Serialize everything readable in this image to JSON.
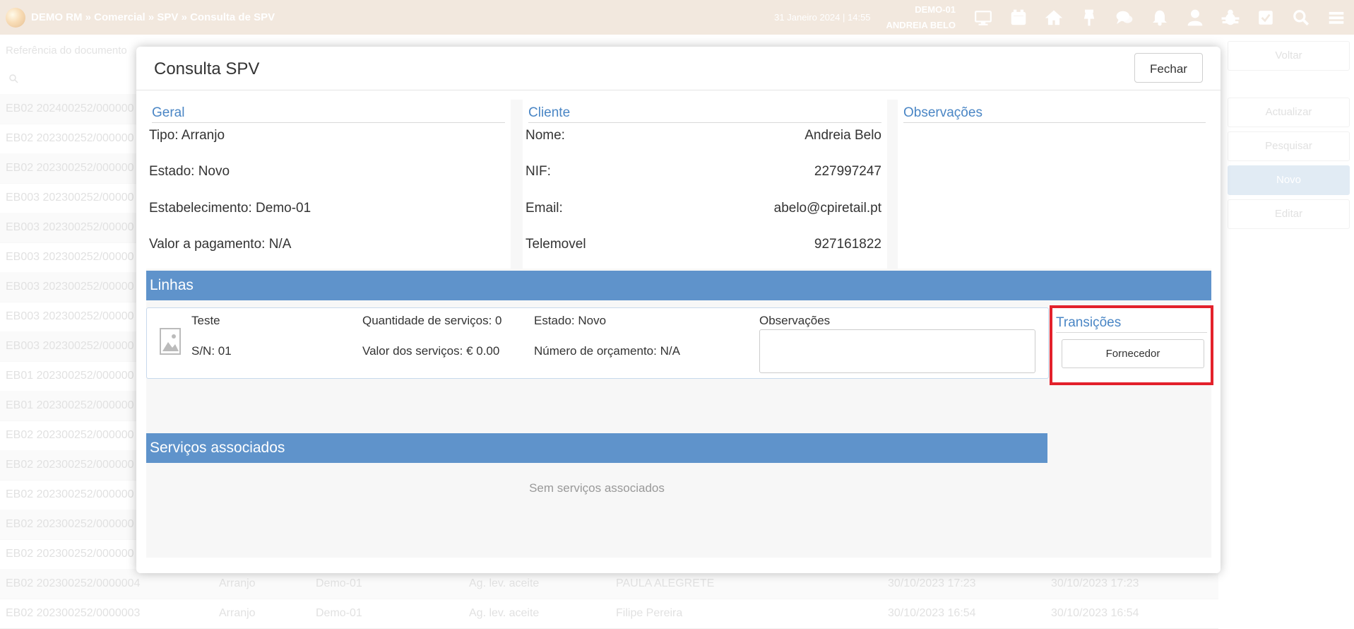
{
  "topbar": {
    "breadcrumb": "DEMO RM » Comercial » SPV » Consulta de SPV",
    "datetime": "31 Janeiro 2024 | 14:55",
    "store": "DEMO-01",
    "user": "ANDREIA BELO",
    "icons": [
      "monitor-icon",
      "calendar-icon",
      "home-icon",
      "pin-icon",
      "chat-icon",
      "bell-icon",
      "user-icon",
      "bug-icon",
      "checkbox-icon",
      "search-icon",
      "menu-icon"
    ]
  },
  "background": {
    "filter_placeholder": "Referência do documento",
    "rows": [
      {
        "ref": "EB02 202400252/000000"
      },
      {
        "ref": "EB02 202300252/000000"
      },
      {
        "ref": "EB02 202300252/000000"
      },
      {
        "ref": "EB003 202300252/00000"
      },
      {
        "ref": "EB003 202300252/00000"
      },
      {
        "ref": "EB003 202300252/00000"
      },
      {
        "ref": "EB003 202300252/00000"
      },
      {
        "ref": "EB003 202300252/00000"
      },
      {
        "ref": "EB003 202300252/00000"
      },
      {
        "ref": "EB01 202300252/000000"
      },
      {
        "ref": "EB01 202300252/000000"
      },
      {
        "ref": "EB02 202300252/000000"
      },
      {
        "ref": "EB02 202300252/000000"
      },
      {
        "ref": "EB02 202300252/000000"
      },
      {
        "ref": "EB02 202300252/000000"
      },
      {
        "ref": "EB02 202300252/000000"
      },
      {
        "ref": "EB02 202300252/0000004",
        "tipo": "Arranjo",
        "estab": "Demo-01",
        "estado": "Ag. lev. aceite",
        "cliente": "PAULA ALEGRETE",
        "d1": "30/10/2023 17:23",
        "d2": "30/10/2023 17:23"
      },
      {
        "ref": "EB02 202300252/0000003",
        "tipo": "Arranjo",
        "estab": "Demo-01",
        "estado": "Ag. lev. aceite",
        "cliente": "Filipe Pereira",
        "d1": "30/10/2023 16:54",
        "d2": "30/10/2023 16:54"
      }
    ],
    "side_buttons": {
      "voltar": "Voltar",
      "actualizar": "Actualizar",
      "pesquisar": "Pesquisar",
      "novo": "Novo",
      "editar": "Editar"
    }
  },
  "modal": {
    "title": "Consulta SPV",
    "close_label": "Fechar",
    "geral": {
      "title": "Geral",
      "tipo": "Tipo: Arranjo",
      "estado": "Estado: Novo",
      "estabelecimento": "Estabelecimento: Demo-01",
      "valor": "Valor a pagamento: N/A"
    },
    "cliente": {
      "title": "Cliente",
      "nome_label": "Nome:",
      "nome": "Andreia Belo",
      "nif_label": "NIF:",
      "nif": "227997247",
      "email_label": "Email:",
      "email": "abelo@cpiretail.pt",
      "tel_label": "Telemovel",
      "tel": "927161822"
    },
    "observacoes": {
      "title": "Observações"
    },
    "linhas": {
      "title": "Linhas",
      "item": {
        "name": "Teste",
        "serial": "S/N: 01",
        "qtd": "Quantidade de serviços: 0",
        "valor": "Valor dos serviços: € 0.00",
        "estado": "Estado: Novo",
        "orcamento": "Número de orçamento: N/A",
        "obs_label": "Observações"
      }
    },
    "transicoes": {
      "title": "Transições",
      "button": "Fornecedor"
    },
    "servicos": {
      "title": "Serviços associados",
      "empty": "Sem serviços associados"
    }
  }
}
